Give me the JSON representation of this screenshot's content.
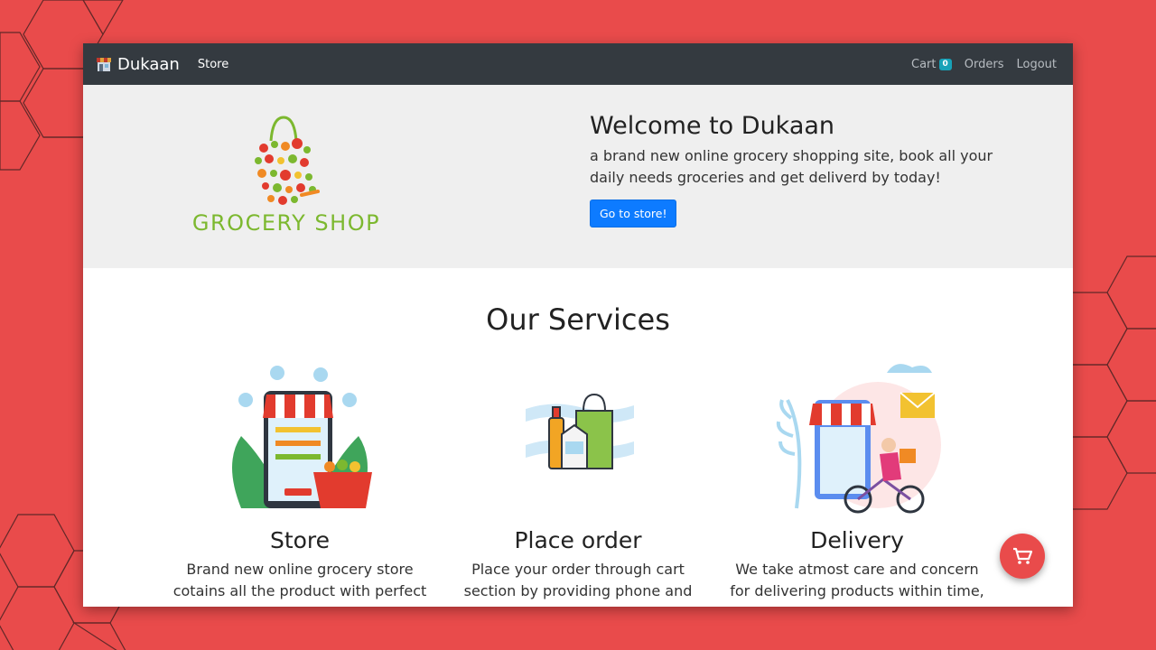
{
  "navbar": {
    "brand": "Dukaan",
    "store_link": "Store",
    "cart_label": "Cart",
    "cart_count": "0",
    "orders_link": "Orders",
    "logout_link": "Logout"
  },
  "hero": {
    "logo_text": "GROCERY SHOP",
    "title": "Welcome to Dukaan",
    "subtitle": "a brand new online grocery shopping site, book all your daily needs groceries and get deliverd by today!",
    "button_label": "Go to store!"
  },
  "services": {
    "title": "Our Services",
    "items": [
      {
        "name": "Store",
        "desc": "Brand new online grocery store cotains all the product with perfect",
        "icon": "storefront-phone-icon"
      },
      {
        "name": "Place order",
        "desc": "Place your order through cart section by providing phone and",
        "icon": "shopping-bag-icon"
      },
      {
        "name": "Delivery",
        "desc": "We take atmost care and concern for delivering products within time,",
        "icon": "delivery-bike-icon"
      }
    ]
  },
  "colors": {
    "background": "#e94b4b",
    "navbar": "#343a40",
    "primary": "#0d7bff",
    "badge": "#17a2b8",
    "hero_bg": "#efefef",
    "logo_green": "#7cb82f"
  }
}
